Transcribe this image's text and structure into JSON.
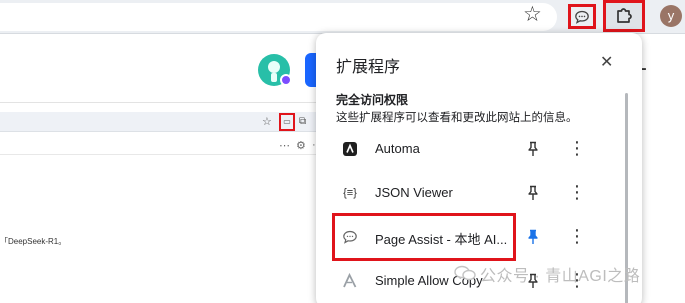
{
  "toolbar": {
    "avatar_letter": "y",
    "highlight_color": "#e0141b"
  },
  "popup": {
    "title": "扩展程序",
    "close_icon": "✕",
    "section_title": "完全访问权限",
    "section_desc": "这些扩展程序可以查看和更改此网站上的信息。",
    "extensions": [
      {
        "name": "Automa",
        "icon": "automa-icon",
        "pinned": false
      },
      {
        "name": "JSON Viewer",
        "icon": "json-viewer-icon",
        "icon_text": "{≡}",
        "pinned": false
      },
      {
        "name": "Page Assist - 本地 AI...",
        "icon": "page-assist-icon",
        "pinned": true
      },
      {
        "name": "Simple Allow Copy",
        "icon": "simple-allow-copy-icon",
        "pinned": false
      }
    ],
    "pinned_color": "#1a73e8"
  },
  "background": {
    "snippet_text": "「DeepSeek-R1。"
  },
  "watermark": {
    "text": "公众号 · 青山AGI之路"
  }
}
